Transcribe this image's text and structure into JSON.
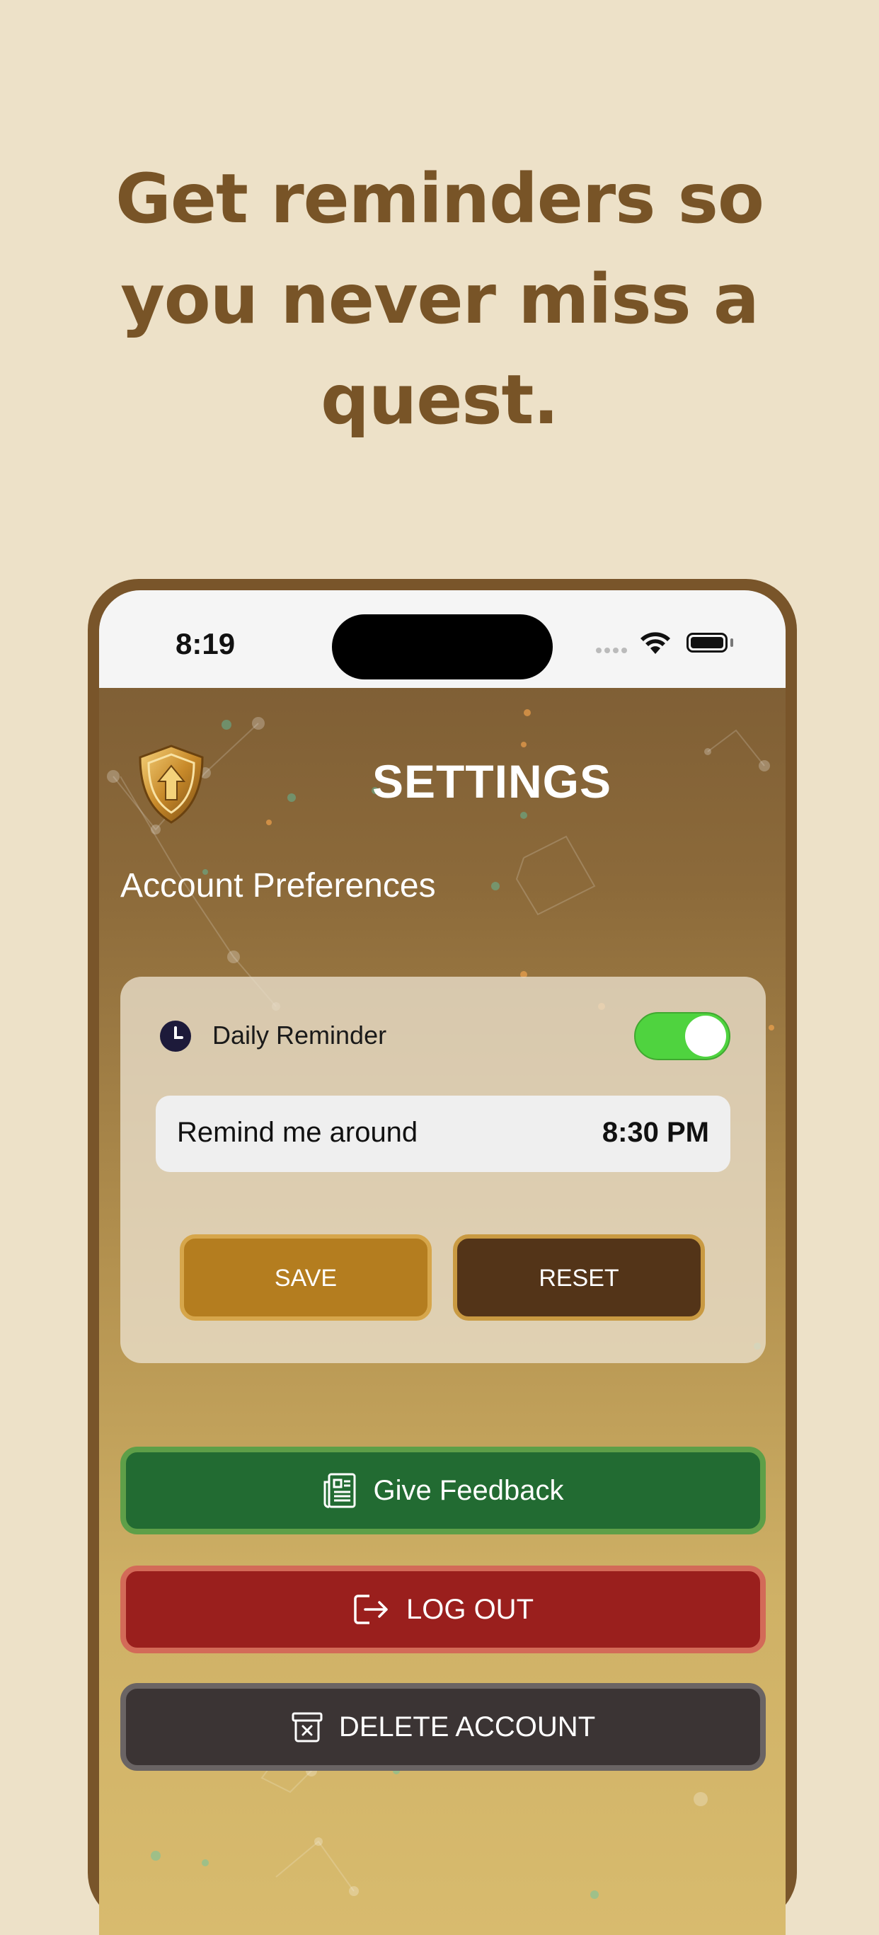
{
  "headline": "Get reminders so you never miss a quest.",
  "status_bar": {
    "time": "8:19"
  },
  "header": {
    "title": "SETTINGS"
  },
  "section": {
    "title": "Account Preferences"
  },
  "reminder": {
    "label": "Daily Reminder",
    "enabled": true,
    "time_label": "Remind me around",
    "time_value": "8:30 PM"
  },
  "buttons": {
    "save": "SAVE",
    "reset": "RESET",
    "feedback": "Give Feedback",
    "logout": "LOG OUT",
    "delete": "DELETE ACCOUNT"
  },
  "icons": {
    "logo": "shield-logo-icon",
    "clock": "clock-icon",
    "feedback": "newspaper-icon",
    "logout": "logout-icon",
    "delete": "trash-box-icon"
  },
  "colors": {
    "background": "#ede1c8",
    "headline": "#785427",
    "phone_frame": "#79552a",
    "toggle_on": "#4fd33f",
    "save": "#b47d1f",
    "reset": "#533418",
    "feedback": "#226b32",
    "logout": "#9a1f1d",
    "delete": "#3b3434"
  }
}
